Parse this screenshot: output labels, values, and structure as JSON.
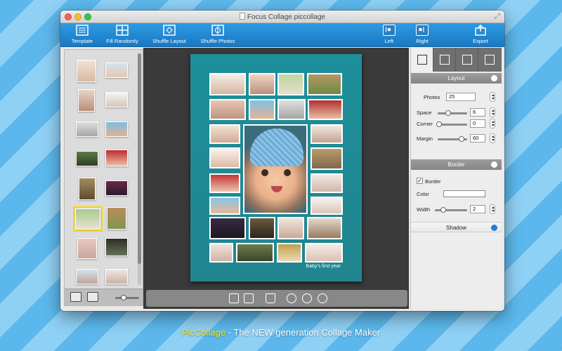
{
  "window": {
    "title": "Focus Collage.piccollage"
  },
  "toolbar": {
    "template": "Template",
    "fill_randomly": "Fill Randomly",
    "shuffle_layout": "Shuffle Layout",
    "shuffle_photos": "Shuffle Photos",
    "left": "Left",
    "right": "Right",
    "export": "Export"
  },
  "poster": {
    "caption": "Baby's first year"
  },
  "layout": {
    "header": "Layout",
    "photos_label": "Photos",
    "photos_value": "25",
    "space_label": "Space",
    "space_value": "6",
    "corner_label": "Corner",
    "corner_value": "0",
    "margin_label": "Margin",
    "margin_value": "60"
  },
  "border": {
    "header": "Border",
    "checkbox_label": "Border",
    "checked": true,
    "color_label": "Color",
    "color_value": "#ffffff",
    "width_label": "Width",
    "width_value": "2"
  },
  "shadow": {
    "header": "Shadow"
  },
  "tagline": {
    "brand": "PicCollage",
    "rest": " - The NEW generation Collage Maker"
  },
  "colors": {
    "accent": "#1e86d6",
    "poster": "#1c8f9a",
    "highlight": "#ffe70f"
  }
}
